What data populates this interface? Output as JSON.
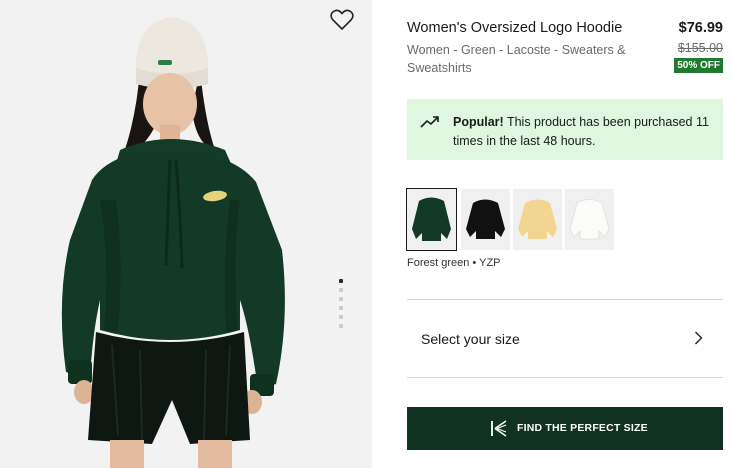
{
  "product": {
    "title": "Women's Oversized Logo Hoodie",
    "price": "$76.99",
    "breadcrumb": "Women - Green - Lacoste - Sweaters & Sweatshirts",
    "original_price": "$155.00",
    "discount_badge": "50% OFF"
  },
  "popular": {
    "heading": "Popular!",
    "message": "This product has been purchased 11 times in the last 48 hours.",
    "icon": "trending-up-icon"
  },
  "colors": {
    "options": [
      "Forest green",
      "Black",
      "Light yellow",
      "White"
    ],
    "selected_label": "Forest green • YZP"
  },
  "size": {
    "label": "Select your size"
  },
  "cta": {
    "label": "FIND THE PERFECT SIZE",
    "icon": "kiwi-sizing-icon"
  },
  "gallery": {
    "image_count": 6,
    "active_index": 0,
    "favorite_icon": "heart-outline-icon"
  },
  "colors_hex": {
    "forest_green": "#0f3320",
    "popular_bg": "#dff7de",
    "badge_green": "#1f7a2f"
  }
}
